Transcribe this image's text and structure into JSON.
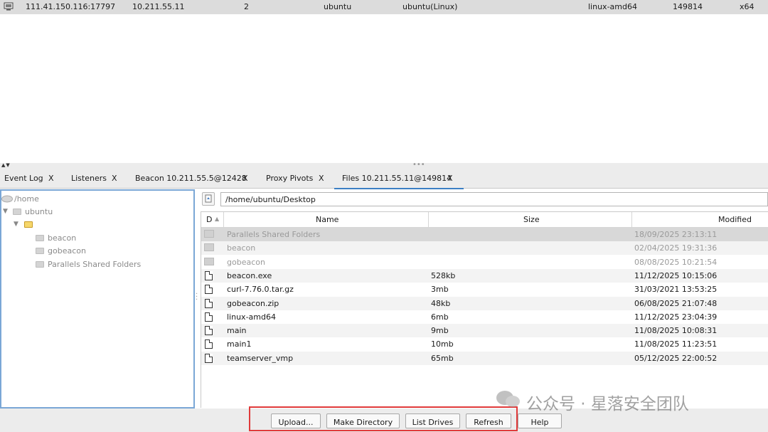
{
  "session": {
    "external": "111.41.150.116:17797",
    "internal": "10.211.55.11",
    "pid_count": "2",
    "user": "ubuntu",
    "computer": "ubuntu(Linux)",
    "process": "linux-amd64",
    "pid": "149814",
    "arch": "x64",
    "icon": "computer-icon"
  },
  "tabs": [
    {
      "label": "Event Log",
      "close": "X"
    },
    {
      "label": "Listeners",
      "close": "X"
    },
    {
      "label": "Beacon 10.211.55.5@12428",
      "close": "X"
    },
    {
      "label": "Proxy Pivots",
      "close": "X"
    },
    {
      "label": "Files 10.211.55.11@149814",
      "close": "X",
      "active": true
    }
  ],
  "tree": {
    "root": "/home",
    "user": "ubuntu",
    "children": [
      "beacon",
      "gobeacon",
      "Parallels Shared Folders"
    ]
  },
  "path": "/home/ubuntu/Desktop",
  "table": {
    "headers": {
      "d": "D",
      "name": "Name",
      "size": "Size",
      "modified": "Modified"
    },
    "rows": [
      {
        "type": "dir",
        "name": "Parallels Shared Folders",
        "size": "",
        "modified": "18/09/2025 23:13:11"
      },
      {
        "type": "dir",
        "name": "beacon",
        "size": "",
        "modified": "02/04/2025 19:31:36"
      },
      {
        "type": "dir",
        "name": "gobeacon",
        "size": "",
        "modified": "08/08/2025 10:21:54"
      },
      {
        "type": "file",
        "name": "beacon.exe",
        "size": "528kb",
        "modified": "11/12/2025 10:15:06"
      },
      {
        "type": "file",
        "name": "curl-7.76.0.tar.gz",
        "size": "3mb",
        "modified": "31/03/2021 13:53:25"
      },
      {
        "type": "file",
        "name": "gobeacon.zip",
        "size": "48kb",
        "modified": "06/08/2025 21:07:48"
      },
      {
        "type": "file",
        "name": "linux-amd64",
        "size": "6mb",
        "modified": "11/12/2025 23:04:39"
      },
      {
        "type": "file",
        "name": "main",
        "size": "9mb",
        "modified": "11/08/2025 10:08:31"
      },
      {
        "type": "file",
        "name": "main1",
        "size": "10mb",
        "modified": "11/08/2025 11:23:51"
      },
      {
        "type": "file",
        "name": "teamserver_vmp",
        "size": "65mb",
        "modified": "05/12/2025 22:00:52"
      }
    ]
  },
  "buttons": {
    "upload": "Upload...",
    "make_directory": "Make Directory",
    "list_drives": "List Drives",
    "refresh": "Refresh",
    "help": "Help"
  },
  "watermark": "公众号 · 星落安全团队",
  "colors": {
    "highlight": "#e03a3a",
    "active_tab": "#3c7fc4",
    "selected_row": "#d8d8d8"
  }
}
